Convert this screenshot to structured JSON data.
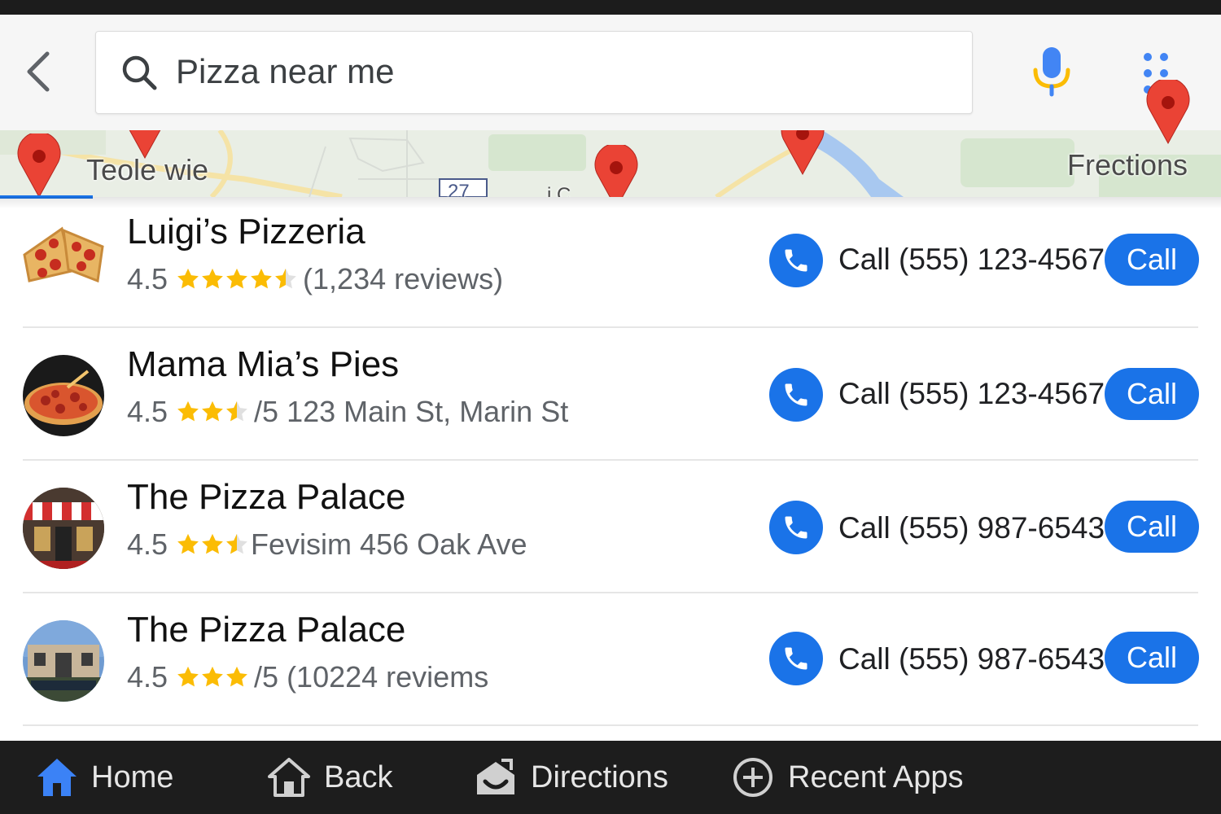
{
  "search": {
    "query": "Pizza near me"
  },
  "map": {
    "labels": [
      "Teole wie",
      "Frections",
      "27",
      "i C"
    ]
  },
  "results": [
    {
      "name": "Luigi’s Pizzeria",
      "rating": "4.5",
      "stars": 4.5,
      "detail": "(1,234 reviews)",
      "phone_label": "Call (555) 123-4567",
      "call_label": "Call"
    },
    {
      "name": "Mama Mia’s Pies",
      "rating": "4.5",
      "stars": 2.5,
      "detail": "/5 123 Main St, Marin St",
      "phone_label": "Call (555) 123-4567",
      "call_label": "Call"
    },
    {
      "name": "The Pizza Palace",
      "rating": "4.5",
      "stars": 2.5,
      "detail": "Fevisim 456 Oak Ave",
      "phone_label": "Call (555) 987-6543",
      "call_label": "Call"
    },
    {
      "name": "The Pizza Palace",
      "rating": "4.5",
      "stars": 3,
      "detail": "/5 (10224 reviems",
      "phone_label": "Call (555) 987-6543",
      "call_label": "Call"
    }
  ],
  "nav": {
    "home": "Home",
    "back": "Back",
    "directions": "Directions",
    "recent": "Recent Apps"
  },
  "colors": {
    "accent": "#1a73e8",
    "star": "#fbbc04",
    "pin": "#ea4335",
    "navbar": "#1d1d1d"
  },
  "icons": [
    "back-arrow-icon",
    "search-icon",
    "mic-icon",
    "apps-dots-icon",
    "map-pin-icon",
    "phone-icon",
    "star-icon",
    "home-icon",
    "back-house-icon",
    "directions-icon",
    "recent-apps-icon"
  ]
}
